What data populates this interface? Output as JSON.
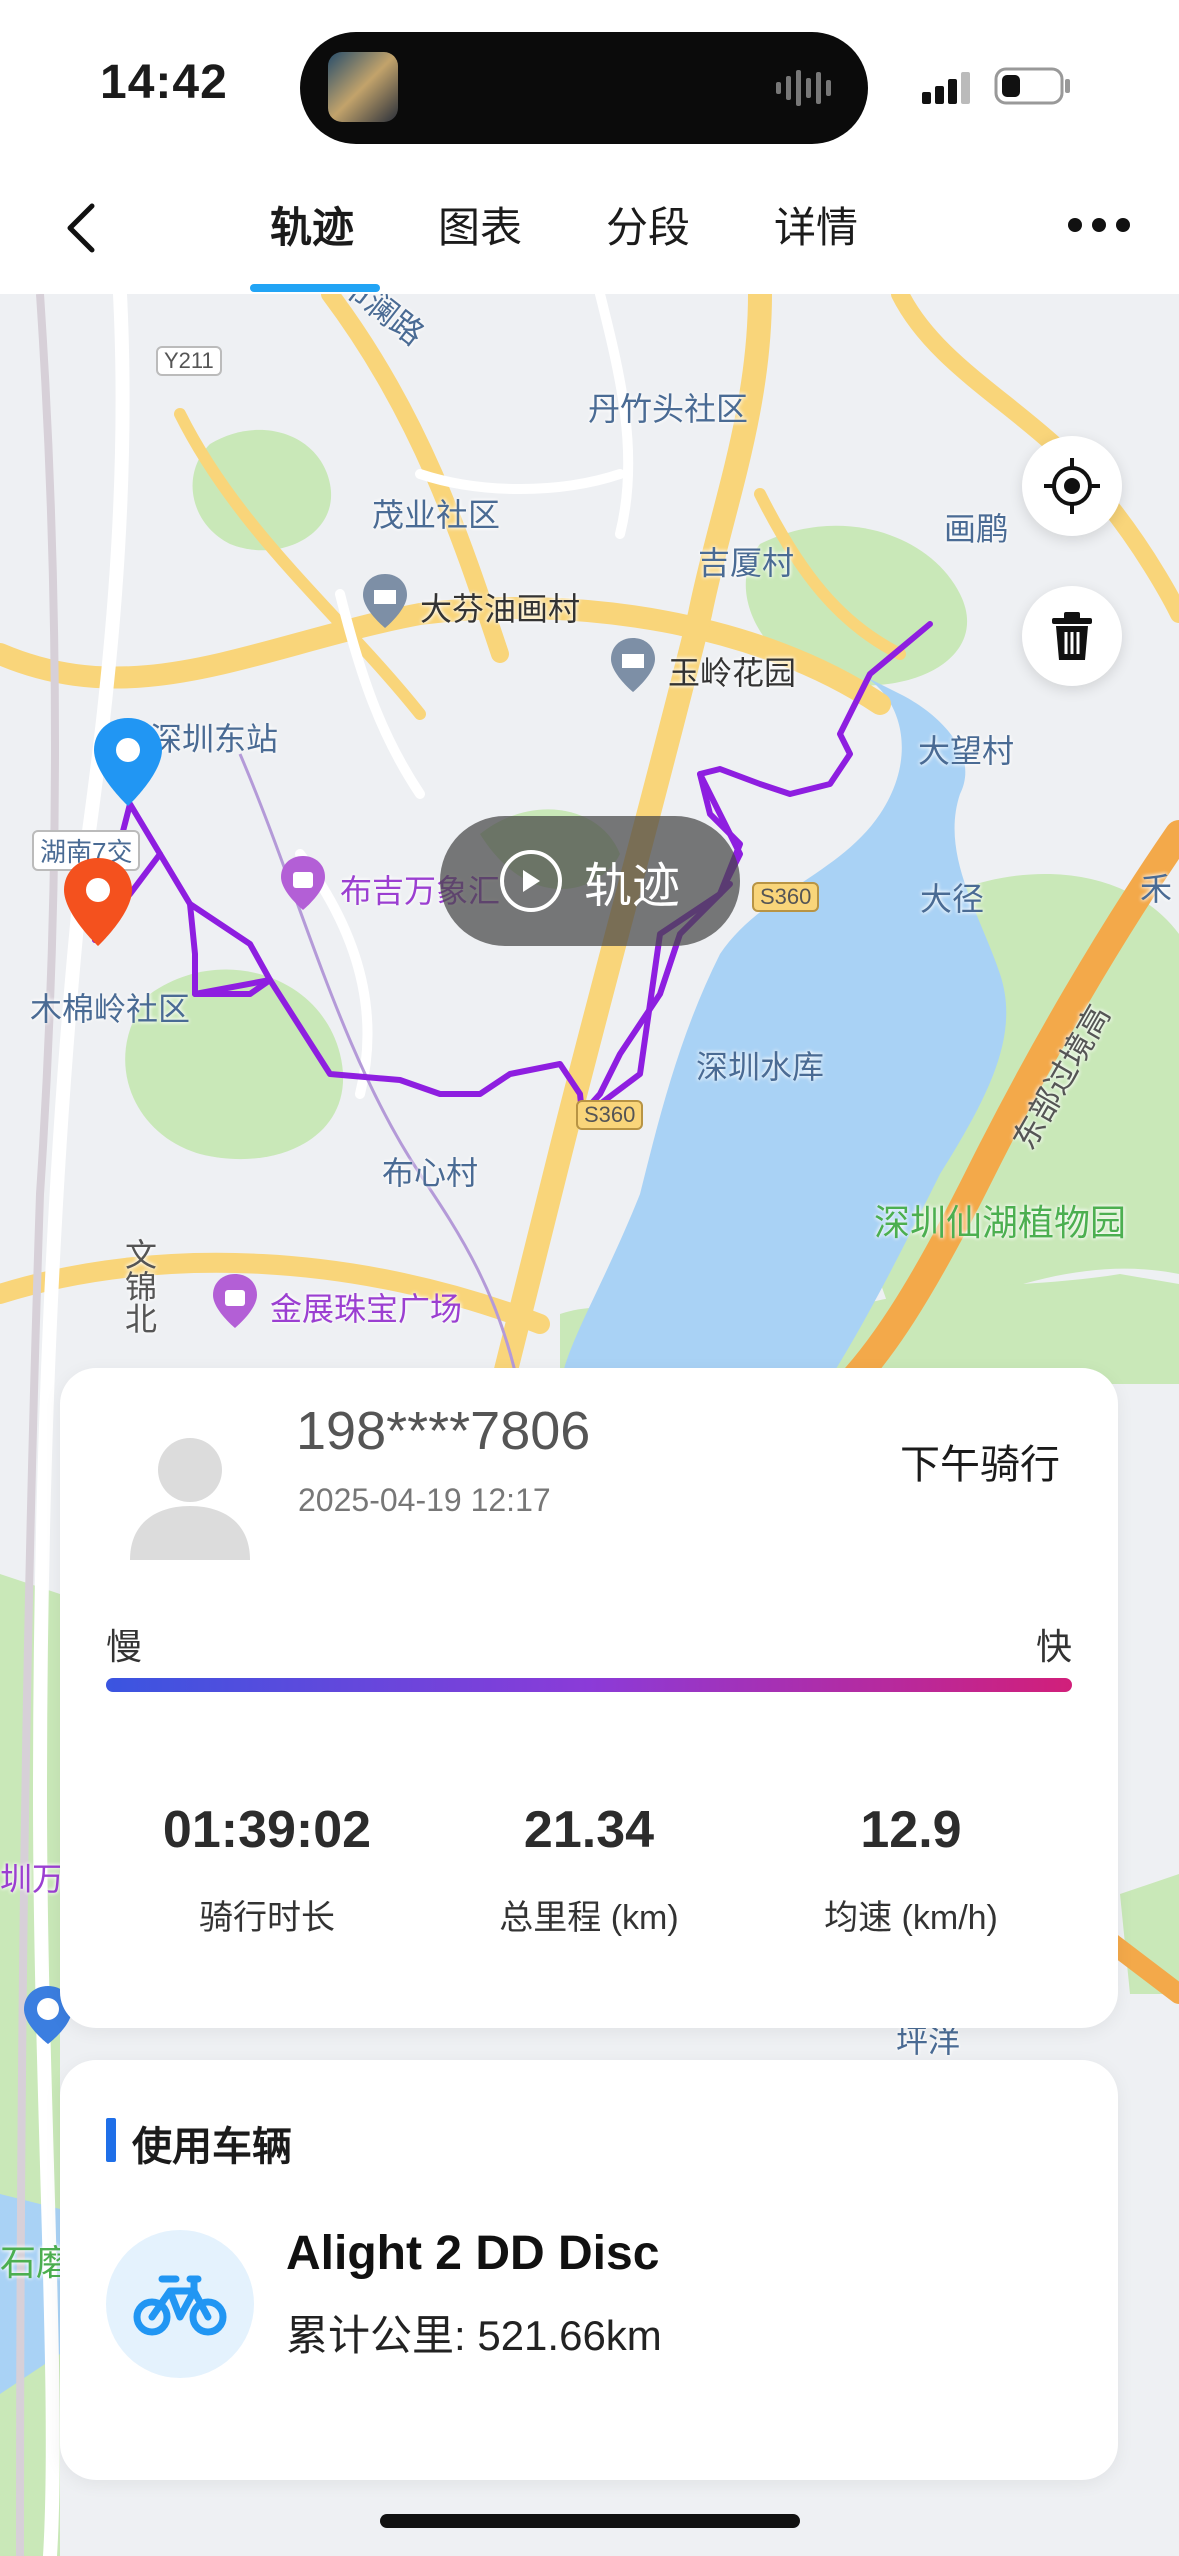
{
  "status": {
    "time": "14:42"
  },
  "nav": {
    "tabs": [
      "轨迹",
      "图表",
      "分段",
      "详情"
    ],
    "active_tab": "轨迹"
  },
  "map": {
    "labels": {
      "road_buxi": "布澜路",
      "y211": "Y211",
      "danzhu": "丹竹头社区",
      "maoye": "茂业社区",
      "huahe": "画鹛",
      "jisha": "吉厦村",
      "dafen": "大芬油画村",
      "yuling": "玉岭花园",
      "dongzhan": "深圳东站",
      "dawang": "大望村",
      "hunan": "湖南7交",
      "bujiwanxiang": "布吉万象汇",
      "s360a": "S360",
      "dajing": "大径",
      "dongbu": "东部过境高",
      "mumian": "木棉岭社区",
      "shuiku": "深圳水库",
      "s360b": "S360",
      "buxin": "布心村",
      "xianhu": "深圳仙湖植物园",
      "wenjin": "文锦北",
      "jinzhan": "金展珠宝广场",
      "pingyang": "坪洋",
      "shi": "石磨",
      "zhen": "圳万",
      "he": "禾"
    },
    "play_label": "轨迹",
    "route_color": "#8e1ee0",
    "start_pin_color": "#2196f3",
    "end_pin_color": "#f4511e"
  },
  "ride": {
    "user": "198****7806",
    "datetime": "2025-04-19 12:17",
    "type": "下午骑行",
    "speed_slow": "慢",
    "speed_fast": "快",
    "duration": "01:39:02",
    "duration_label": "骑行时长",
    "distance": "21.34",
    "distance_label": "总里程 (km)",
    "avg_speed": "12.9",
    "avg_speed_label": "均速 (km/h)"
  },
  "vehicle": {
    "section_title": "使用车辆",
    "name": "Alight 2 DD Disc",
    "mileage": "累计公里: 521.66km",
    "icon_color": "#2196f3"
  }
}
